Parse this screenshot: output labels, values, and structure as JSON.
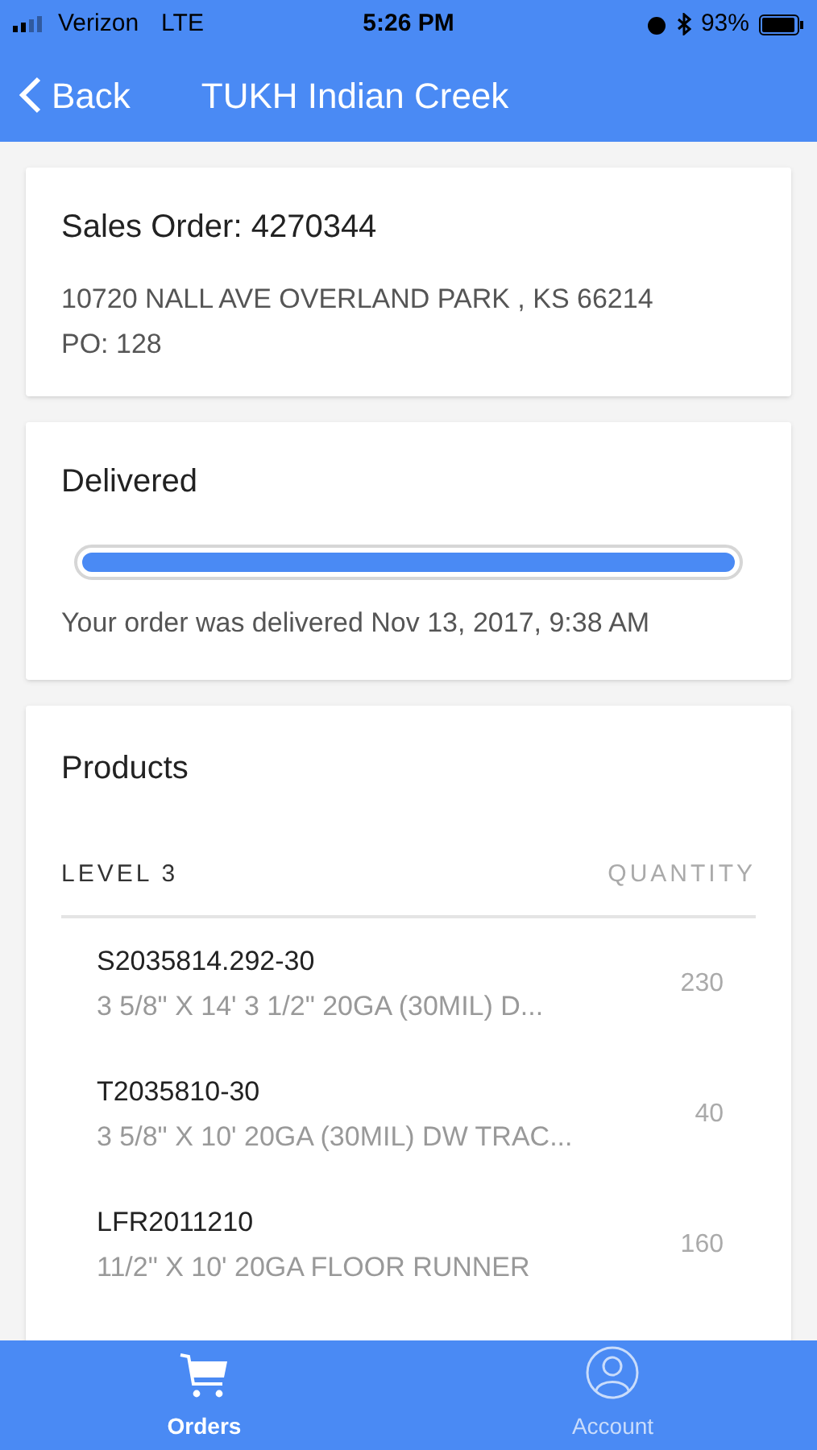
{
  "status_bar": {
    "carrier": "Verizon",
    "network": "LTE",
    "time": "5:26 PM",
    "battery": "93%"
  },
  "nav": {
    "back": "Back",
    "title": "TUKH Indian Creek"
  },
  "order": {
    "title": "Sales Order: 4270344",
    "address": "10720 NALL AVE OVERLAND PARK , KS 66214",
    "po": "PO: 128"
  },
  "delivery": {
    "title": "Delivered",
    "level": 1,
    "message": "Your order was delivered Nov 13, 2017, 9:38 AM"
  },
  "products": {
    "title": "Products",
    "columns": [
      "LEVEL 3",
      "QUANTITY"
    ],
    "rows": [
      {
        "code": "S2035814.292-30",
        "description": "3 5/8\" X 14' 3 1/2\" 20GA (30MIL) D...",
        "quantity": "230"
      },
      {
        "code": "T2035810-30",
        "description": "3 5/8\" X 10' 20GA (30MIL) DW TRAC...",
        "quantity": "40"
      },
      {
        "code": "LFR2011210",
        "description": "11/2\" X 10' 20GA FLOOR RUNNER",
        "quantity": "160"
      }
    ]
  },
  "tabs": [
    {
      "label": "Orders",
      "selected": true
    },
    {
      "label": "Account",
      "selected": false
    }
  ]
}
